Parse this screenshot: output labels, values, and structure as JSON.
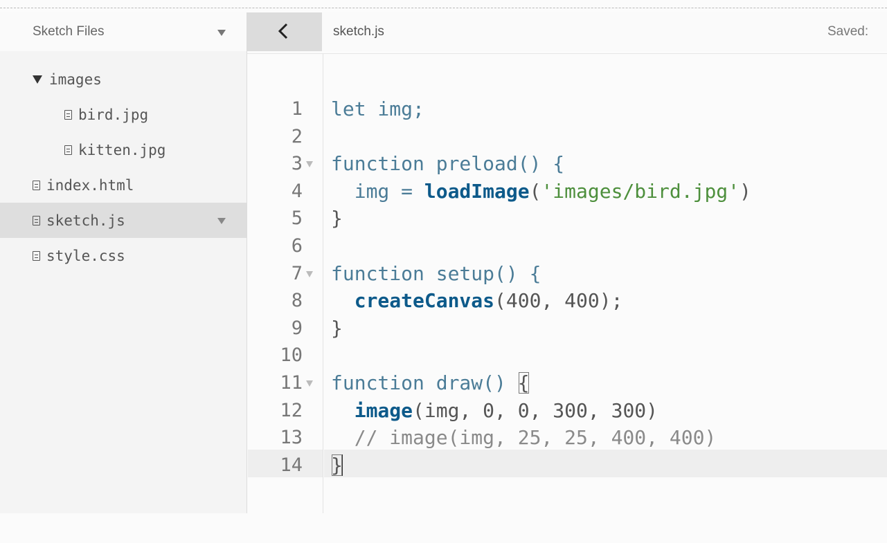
{
  "sidebar": {
    "title": "Sketch Files",
    "items": [
      {
        "label": "images",
        "type": "folder"
      },
      {
        "label": "bird.jpg",
        "type": "file"
      },
      {
        "label": "kitten.jpg",
        "type": "file"
      },
      {
        "label": "index.html",
        "type": "file"
      },
      {
        "label": "sketch.js",
        "type": "file",
        "selected": true
      },
      {
        "label": "style.css",
        "type": "file"
      }
    ]
  },
  "editor": {
    "file_name": "sketch.js",
    "status": "Saved:",
    "line_numbers": [
      "1",
      "2",
      "3",
      "4",
      "5",
      "6",
      "7",
      "8",
      "9",
      "10",
      "11",
      "12",
      "13",
      "14"
    ],
    "code": {
      "l1_kw": "let",
      "l1_rest": " img;",
      "l3_kw": "function",
      "l3_rest": " preload() {",
      "l4_pre": "  img = ",
      "l4_fn": "loadImage",
      "l4_open": "(",
      "l4_str": "'images/bird.jpg'",
      "l4_close": ")",
      "l5": "}",
      "l7_kw": "function",
      "l7_rest": " setup() {",
      "l8_pre": "  ",
      "l8_fn": "createCanvas",
      "l8_rest": "(400, 400);",
      "l9": "}",
      "l11_kw": "function",
      "l11_rest": " draw() ",
      "l11_brace": "{",
      "l12_pre": "  ",
      "l12_fn": "image",
      "l12_rest": "(img, 0, 0, 300, 300)",
      "l13": "  // image(img, 25, 25, 400, 400)",
      "l14": "}"
    }
  },
  "colors": {
    "keyword": "#4b7c97",
    "function": "#0d5a8a",
    "string": "#4d8f3c",
    "comment": "#8a8a8a"
  }
}
